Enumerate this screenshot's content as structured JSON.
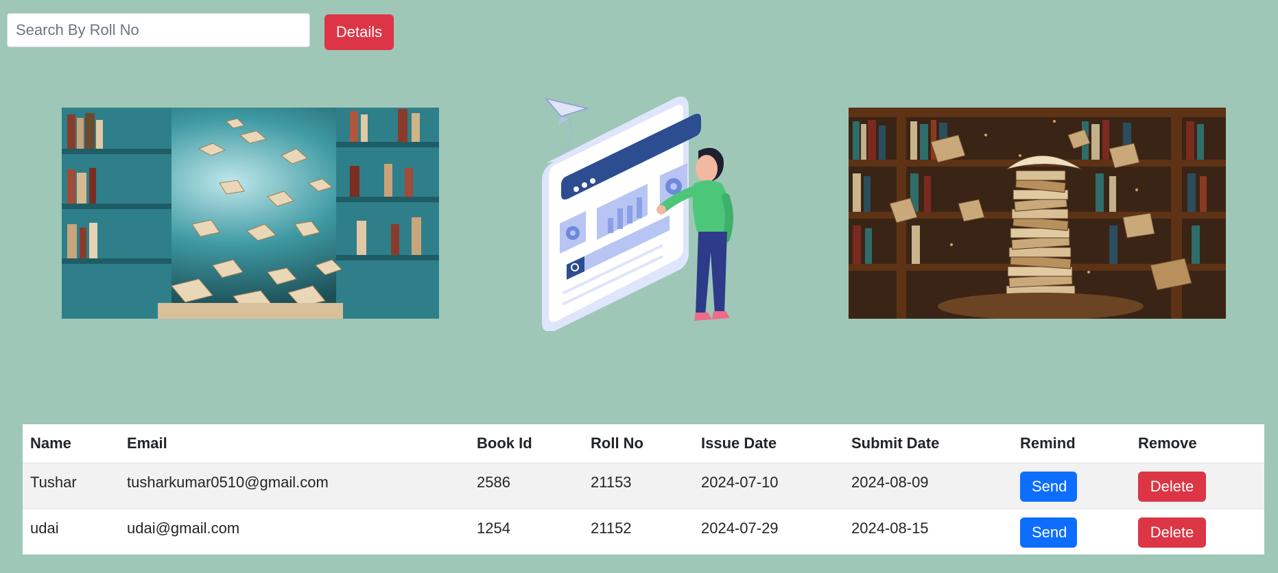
{
  "search": {
    "placeholder": "Search By Roll No",
    "value": ""
  },
  "details_button": {
    "label": "Details"
  },
  "images": {
    "left": "flying-books-library-photo",
    "center": "person-dashboard-illustration",
    "right": "book-stack-library-photo"
  },
  "table": {
    "headers": [
      "Name",
      "Email",
      "Book Id",
      "Roll No",
      "Issue Date",
      "Submit Date",
      "Remind",
      "Remove"
    ],
    "rows": [
      {
        "name": "Tushar",
        "email": "tusharkumar0510@gmail.com",
        "book_id": "2586",
        "roll_no": "21153",
        "issue_date": "2024-07-10",
        "submit_date": "2024-08-09",
        "remind_label": "Send",
        "remove_label": "Delete"
      },
      {
        "name": "udai",
        "email": "udai@gmail.com",
        "book_id": "1254",
        "roll_no": "21152",
        "issue_date": "2024-07-29",
        "submit_date": "2024-08-15",
        "remind_label": "Send",
        "remove_label": "Delete"
      }
    ]
  },
  "colors": {
    "background": "#9ec7b8",
    "danger": "#dc3545",
    "primary": "#0d6efd"
  }
}
